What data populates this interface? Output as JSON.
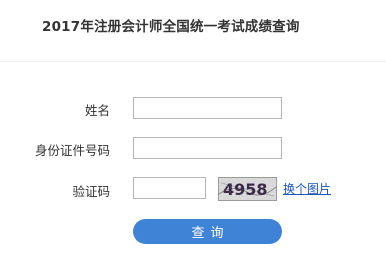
{
  "page": {
    "title": "2017年注册会计师全国统一考试成绩查询"
  },
  "form": {
    "name_label": "姓名",
    "name_value": "",
    "id_label": "身份证件号码",
    "id_value": "",
    "captcha_label": "验证码",
    "captcha_value": "",
    "captcha_image_text": "4958",
    "change_image_link": "换个图片",
    "submit_label": "查询"
  },
  "colors": {
    "accent_button": "#3f83d6",
    "link": "#1a55b8"
  }
}
